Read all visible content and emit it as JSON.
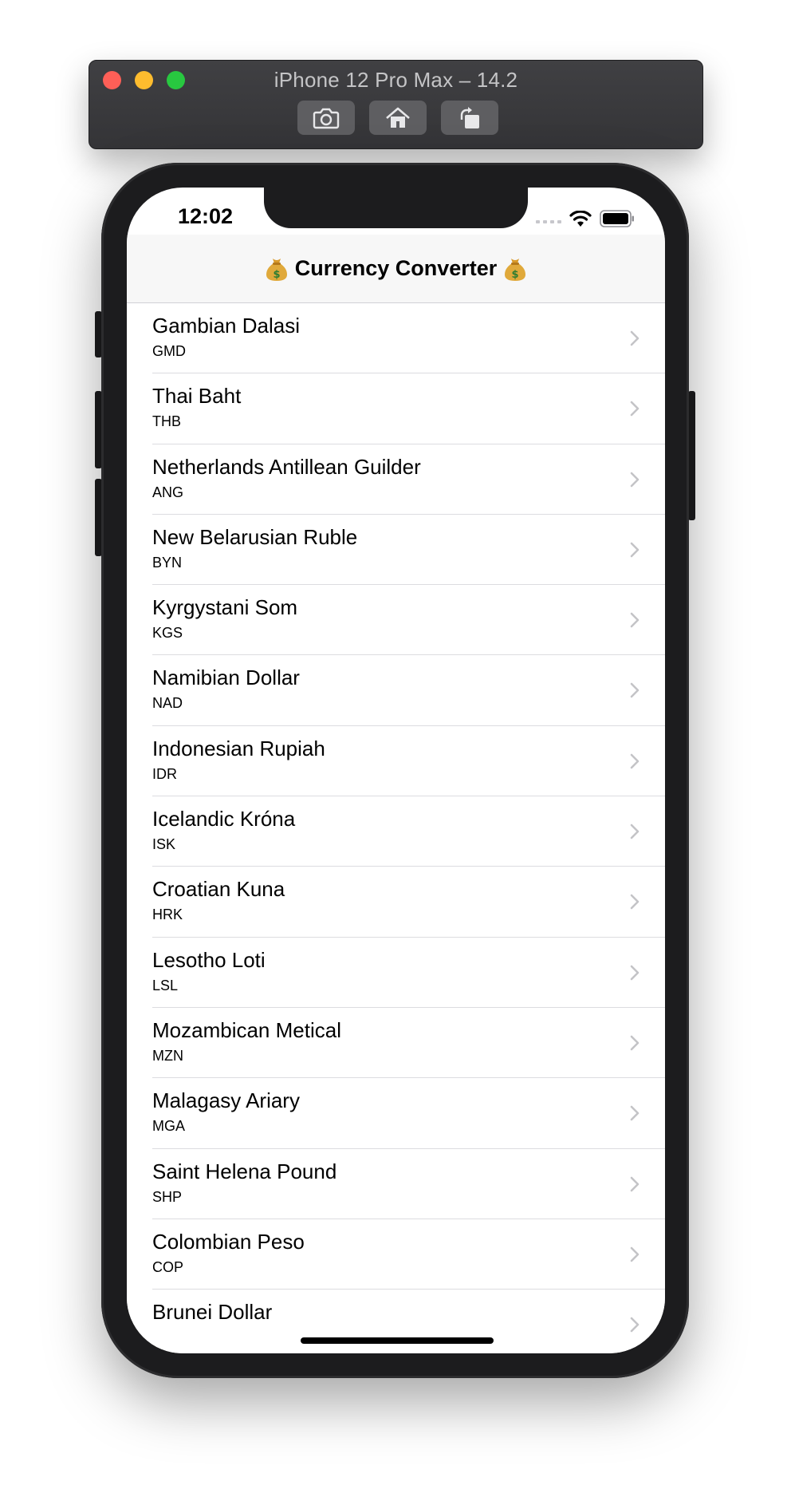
{
  "simulator": {
    "title": "iPhone 12 Pro Max – 14.2",
    "buttons": [
      {
        "icon": "camera-icon"
      },
      {
        "icon": "home-icon"
      },
      {
        "icon": "rotate-icon"
      }
    ]
  },
  "status_bar": {
    "time": "12:02"
  },
  "nav": {
    "title": "Currency Converter",
    "icon": "money-bag-icon"
  },
  "currencies": [
    {
      "name": "Gambian Dalasi",
      "code": "GMD"
    },
    {
      "name": "Thai Baht",
      "code": "THB"
    },
    {
      "name": "Netherlands Antillean Guilder",
      "code": "ANG"
    },
    {
      "name": "New Belarusian Ruble",
      "code": "BYN"
    },
    {
      "name": "Kyrgystani Som",
      "code": "KGS"
    },
    {
      "name": "Namibian Dollar",
      "code": "NAD"
    },
    {
      "name": "Indonesian Rupiah",
      "code": "IDR"
    },
    {
      "name": "Icelandic Króna",
      "code": "ISK"
    },
    {
      "name": "Croatian Kuna",
      "code": "HRK"
    },
    {
      "name": "Lesotho Loti",
      "code": "LSL"
    },
    {
      "name": "Mozambican Metical",
      "code": "MZN"
    },
    {
      "name": "Malagasy Ariary",
      "code": "MGA"
    },
    {
      "name": "Saint Helena Pound",
      "code": "SHP"
    },
    {
      "name": "Colombian Peso",
      "code": "COP"
    },
    {
      "name": "Brunei Dollar",
      "code": ""
    }
  ],
  "colors": {
    "nav_background": "#f7f7f7",
    "separator": "#dcdce0",
    "chevron": "#c4c4c7",
    "phone_frame": "#1c1c1e"
  }
}
